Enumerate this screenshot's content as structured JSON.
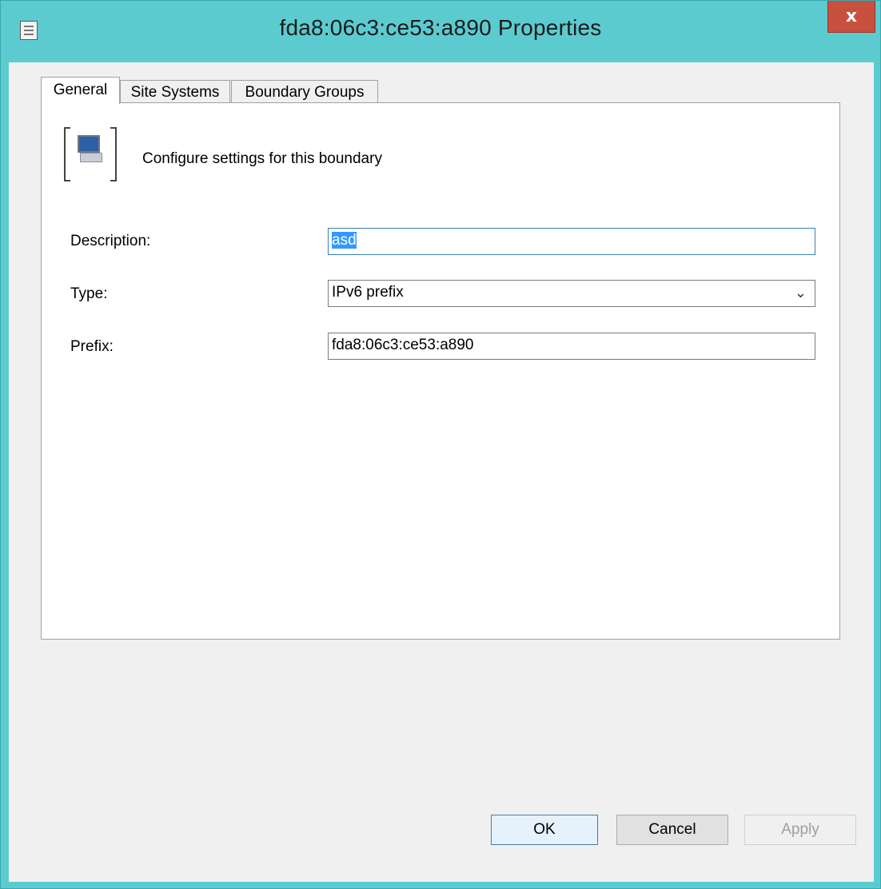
{
  "window": {
    "title": "fda8:06c3:ce53:a890 Properties",
    "close_glyph": "x",
    "icon": "properties-page-icon"
  },
  "tabs": [
    {
      "label": "General",
      "active": true
    },
    {
      "label": "Site Systems",
      "active": false
    },
    {
      "label": "Boundary Groups",
      "active": false
    }
  ],
  "general": {
    "header_text": "Configure settings for this boundary",
    "header_icon": "computer-boundary-icon",
    "description": {
      "label": "Description:",
      "value": "asd"
    },
    "type": {
      "label": "Type:",
      "value": "IPv6 prefix"
    },
    "prefix": {
      "label": "Prefix:",
      "value": "fda8:06c3:ce53:a890"
    }
  },
  "buttons": {
    "ok": "OK",
    "cancel": "Cancel",
    "apply": "Apply"
  },
  "colors": {
    "title_bar": "#5ccbd0",
    "close_button": "#c7503f",
    "selection": "#3399ff"
  }
}
